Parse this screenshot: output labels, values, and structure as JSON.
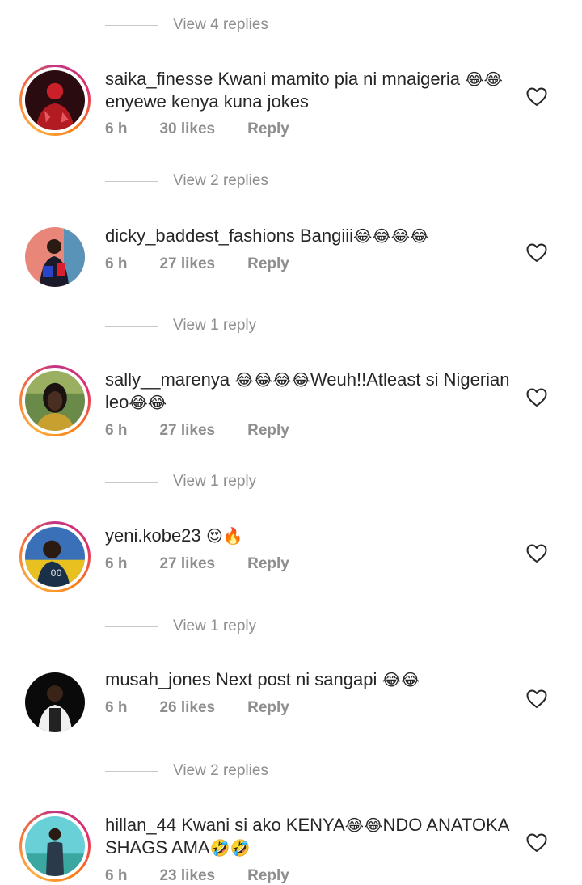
{
  "view_replies_top": "View 4 replies",
  "comments": [
    {
      "user": "saika_finesse",
      "text": "Kwani mamito pia ni mnaigeria ",
      "emoji_a": "😂😂",
      "text_b": "enyewe kenya kuna jokes",
      "time": "6 h",
      "likes": "30 likes",
      "reply": "Reply",
      "view_replies": "View 2 replies"
    },
    {
      "user": "dicky_baddest_fashions",
      "text": "Bangiii",
      "emoji_a": "😂😂😂😂",
      "time": "6 h",
      "likes": "27 likes",
      "reply": "Reply",
      "view_replies": "View 1 reply"
    },
    {
      "user": "sally__marenya",
      "emoji_a": " 😂😂😂😂",
      "text": "Weuh!!Atleast si Nigerian leo",
      "emoji_b": "😂😂",
      "time": "6 h",
      "likes": "27 likes",
      "reply": "Reply",
      "view_replies": "View 1 reply"
    },
    {
      "user": "yeni.kobe23",
      "emoji_a": " 😍🔥",
      "time": "6 h",
      "likes": "27 likes",
      "reply": "Reply",
      "view_replies": "View 1 reply"
    },
    {
      "user": "musah_jones",
      "text": " Next post ni sangapi ",
      "emoji_a": "😂😂",
      "time": "6 h",
      "likes": "26 likes",
      "reply": "Reply",
      "view_replies": "View 2 replies"
    },
    {
      "user": "hillan_44",
      "text": " Kwani si ako KENYA",
      "emoji_a": "😂😂",
      "text_b": "NDO ANATOKA SHAGS AMA",
      "emoji_b": "🤣🤣",
      "time": "6 h",
      "likes": "23 likes",
      "reply": "Reply"
    }
  ]
}
